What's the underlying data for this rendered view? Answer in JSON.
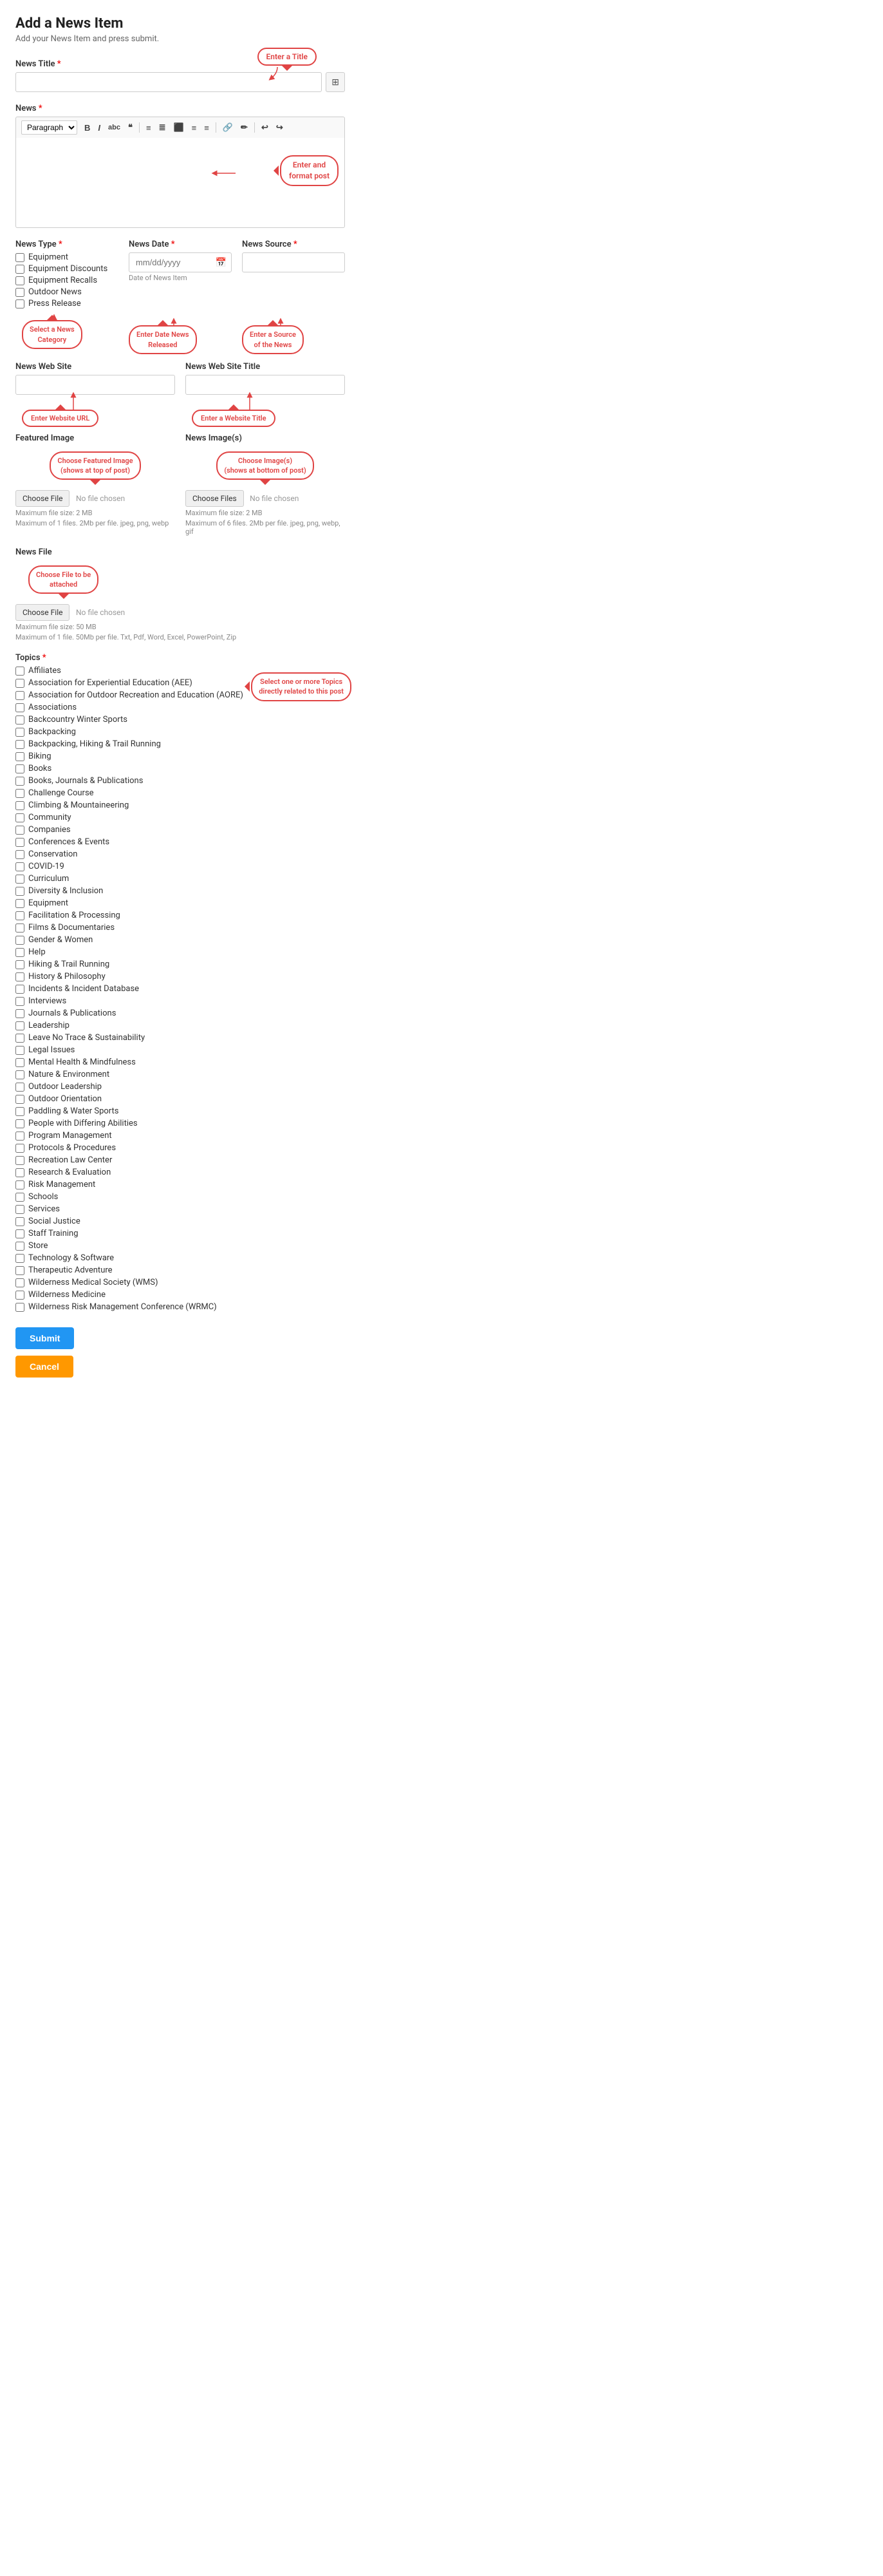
{
  "page": {
    "title": "Add a News Item",
    "subtitle": "Add your News Item and press submit."
  },
  "form": {
    "news_title": {
      "label": "News Title",
      "required": true,
      "placeholder": "",
      "callout": "Enter a Title"
    },
    "news_body": {
      "label": "News",
      "required": true,
      "callout": "Enter and format post",
      "toolbar": {
        "paragraph_label": "Paragraph",
        "buttons": [
          "B",
          "I",
          "\"\"",
          "❝",
          "≡",
          "≣",
          "⬛",
          "≡",
          "≡",
          "🔗",
          "✏",
          "↩",
          "↪"
        ]
      }
    },
    "news_type": {
      "label": "News Type",
      "required": true,
      "callout": "Select a News Category",
      "options": [
        "Equipment",
        "Equipment Discounts",
        "Equipment Recalls",
        "Outdoor News",
        "Press Release"
      ]
    },
    "news_date": {
      "label": "News Date",
      "required": true,
      "callout": "Enter Date News Released",
      "placeholder": "mm/dd/yyyy",
      "hint": "Date of News Item"
    },
    "news_source": {
      "label": "News Source",
      "required": true,
      "callout": "Enter a Source of the News",
      "placeholder": ""
    },
    "news_website": {
      "label": "News Web Site",
      "callout": "Enter Website URL",
      "placeholder": ""
    },
    "news_website_title": {
      "label": "News Web Site Title",
      "callout": "Enter a  Website Title",
      "placeholder": ""
    },
    "featured_image": {
      "label": "Featured Image",
      "callout": "Choose Featured Image\n(shows at top of post)",
      "btn": "Choose File",
      "no_file": "No file chosen",
      "info1": "Maximum file size: 2 MB",
      "info2": "Maximum of 1 files. 2Mb per file. jpeg, png, webp"
    },
    "news_images": {
      "label": "News Image(s)",
      "callout": "Choose Image(s)\n(shows at bottom of post)",
      "btn": "Choose Files",
      "no_file": "No file chosen",
      "info1": "Maximum file size: 2 MB",
      "info2": "Maximum of 6 files. 2Mb per file. jpeg, png, webp, gif"
    },
    "news_file": {
      "label": "News File",
      "callout": "Choose File to be\nattached",
      "btn": "Choose File",
      "no_file": "No file chosen",
      "info1": "Maximum file size: 50 MB",
      "info2": "Maximum of 1 file. 50Mb per file. Txt, Pdf, Word, Excel, PowerPoint, Zip"
    },
    "topics": {
      "label": "Topics",
      "required": true,
      "callout": "Select one or more Topics\ndirectly related to this post",
      "items": [
        "Affiliates",
        "Association for Experiential Education (AEE)",
        "Association for Outdoor Recreation and Education (AORE)",
        "Associations",
        "Backcountry Winter Sports",
        "Backpacking",
        "Backpacking, Hiking & Trail Running",
        "Biking",
        "Books",
        "Books, Journals & Publications",
        "Challenge Course",
        "Climbing & Mountaineering",
        "Community",
        "Companies",
        "Conferences & Events",
        "Conservation",
        "COVID-19",
        "Curriculum",
        "Diversity & Inclusion",
        "Equipment",
        "Facilitation & Processing",
        "Films & Documentaries",
        "Gender & Women",
        "Help",
        "Hiking & Trail Running",
        "History & Philosophy",
        "Incidents & Incident Database",
        "Interviews",
        "Journals & Publications",
        "Leadership",
        "Leave No Trace & Sustainability",
        "Legal Issues",
        "Mental Health & Mindfulness",
        "Nature & Environment",
        "Outdoor Leadership",
        "Outdoor Orientation",
        "Paddling & Water Sports",
        "People with Differing Abilities",
        "Program Management",
        "Protocols & Procedures",
        "Recreation Law Center",
        "Research & Evaluation",
        "Risk Management",
        "Schools",
        "Services",
        "Social Justice",
        "Staff Training",
        "Store",
        "Technology & Software",
        "Therapeutic Adventure",
        "Wilderness Medical Society (WMS)",
        "Wilderness Medicine",
        "Wilderness Risk Management Conference (WRMC)"
      ]
    }
  },
  "buttons": {
    "submit": "Submit",
    "cancel": "Cancel"
  }
}
